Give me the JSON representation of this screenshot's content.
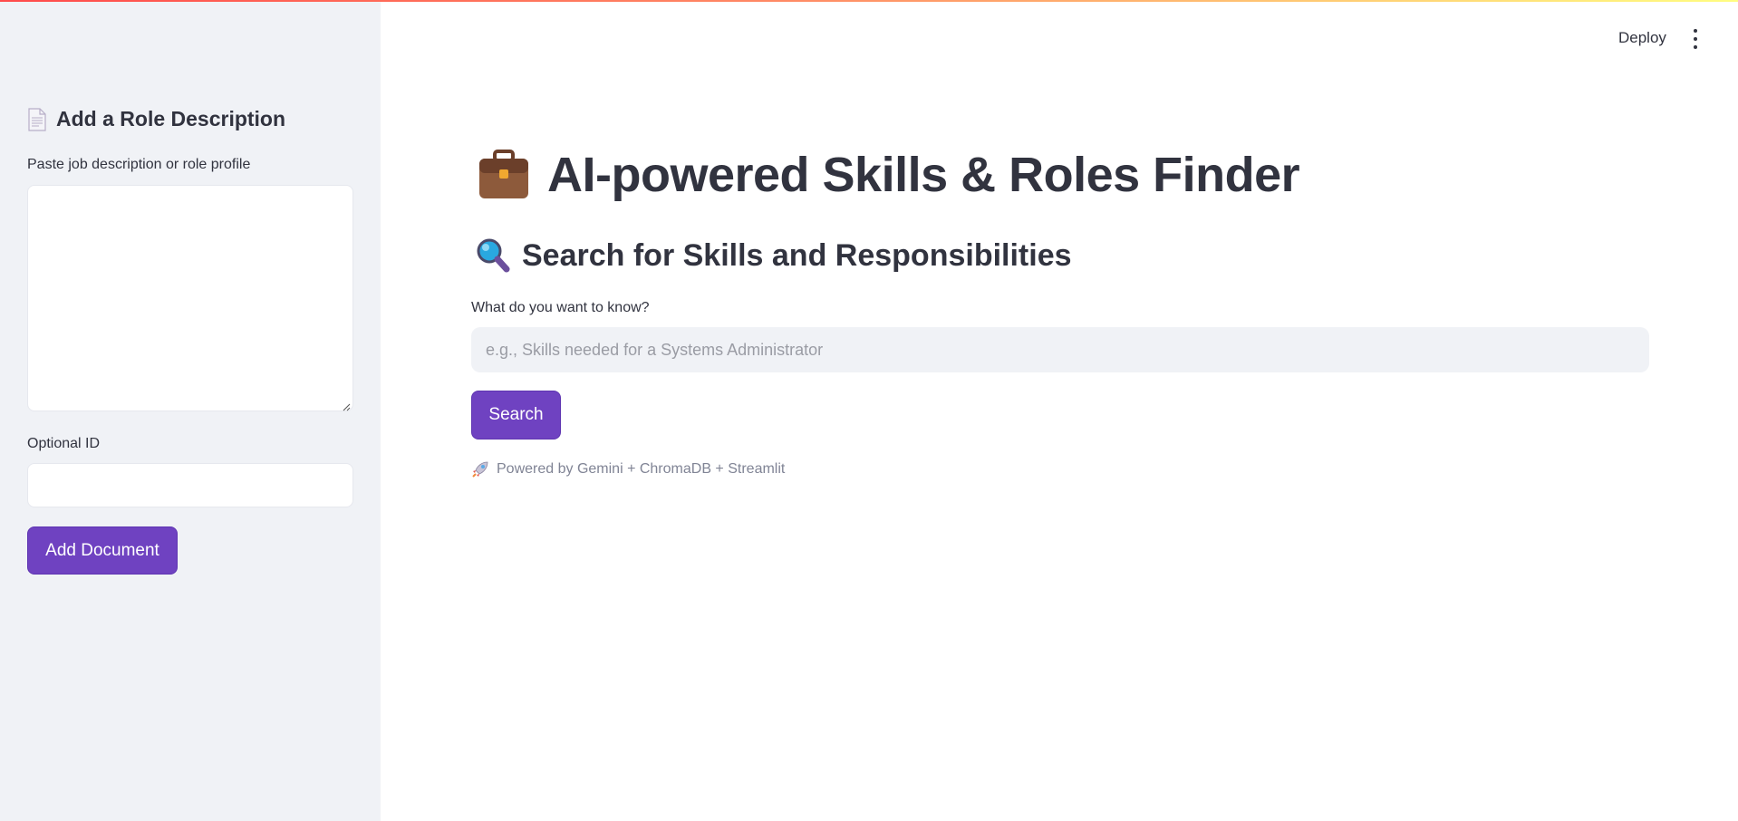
{
  "sidebar": {
    "header_icon": "document-icon",
    "title": "Add a Role Description",
    "description_label": "Paste job description or role profile",
    "description_value": "",
    "id_label": "Optional ID",
    "id_value": "",
    "add_button": "Add Document"
  },
  "header": {
    "deploy": "Deploy",
    "menu_icon": "kebab-menu-icon"
  },
  "main": {
    "title_icon": "briefcase-icon",
    "title": "AI-powered Skills & Roles Finder",
    "subtitle_icon": "magnifier-icon",
    "subtitle": "Search for Skills and Responsibilities",
    "query_label": "What do you want to know?",
    "query_placeholder": "e.g., Skills needed for a Systems Administrator",
    "search_button": "Search",
    "footer_icon": "rocket-icon",
    "footer": "Powered by Gemini + ChromaDB + Streamlit"
  },
  "colors": {
    "accent": "#6f42c1",
    "sidebar_bg": "#f0f2f6",
    "text": "#31333f"
  }
}
